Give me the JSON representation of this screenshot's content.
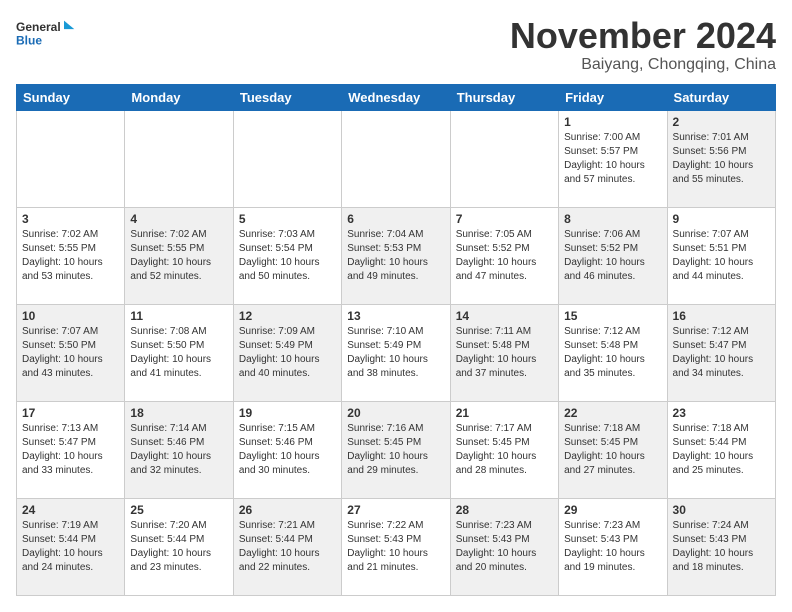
{
  "logo": {
    "line1": "General",
    "line2": "Blue"
  },
  "title": "November 2024",
  "subtitle": "Baiyang, Chongqing, China",
  "weekdays": [
    "Sunday",
    "Monday",
    "Tuesday",
    "Wednesday",
    "Thursday",
    "Friday",
    "Saturday"
  ],
  "weeks": [
    [
      {
        "day": "",
        "info": ""
      },
      {
        "day": "",
        "info": ""
      },
      {
        "day": "",
        "info": ""
      },
      {
        "day": "",
        "info": ""
      },
      {
        "day": "",
        "info": ""
      },
      {
        "day": "1",
        "info": "Sunrise: 7:00 AM\nSunset: 5:57 PM\nDaylight: 10 hours\nand 57 minutes."
      },
      {
        "day": "2",
        "info": "Sunrise: 7:01 AM\nSunset: 5:56 PM\nDaylight: 10 hours\nand 55 minutes."
      }
    ],
    [
      {
        "day": "3",
        "info": "Sunrise: 7:02 AM\nSunset: 5:55 PM\nDaylight: 10 hours\nand 53 minutes."
      },
      {
        "day": "4",
        "info": "Sunrise: 7:02 AM\nSunset: 5:55 PM\nDaylight: 10 hours\nand 52 minutes."
      },
      {
        "day": "5",
        "info": "Sunrise: 7:03 AM\nSunset: 5:54 PM\nDaylight: 10 hours\nand 50 minutes."
      },
      {
        "day": "6",
        "info": "Sunrise: 7:04 AM\nSunset: 5:53 PM\nDaylight: 10 hours\nand 49 minutes."
      },
      {
        "day": "7",
        "info": "Sunrise: 7:05 AM\nSunset: 5:52 PM\nDaylight: 10 hours\nand 47 minutes."
      },
      {
        "day": "8",
        "info": "Sunrise: 7:06 AM\nSunset: 5:52 PM\nDaylight: 10 hours\nand 46 minutes."
      },
      {
        "day": "9",
        "info": "Sunrise: 7:07 AM\nSunset: 5:51 PM\nDaylight: 10 hours\nand 44 minutes."
      }
    ],
    [
      {
        "day": "10",
        "info": "Sunrise: 7:07 AM\nSunset: 5:50 PM\nDaylight: 10 hours\nand 43 minutes."
      },
      {
        "day": "11",
        "info": "Sunrise: 7:08 AM\nSunset: 5:50 PM\nDaylight: 10 hours\nand 41 minutes."
      },
      {
        "day": "12",
        "info": "Sunrise: 7:09 AM\nSunset: 5:49 PM\nDaylight: 10 hours\nand 40 minutes."
      },
      {
        "day": "13",
        "info": "Sunrise: 7:10 AM\nSunset: 5:49 PM\nDaylight: 10 hours\nand 38 minutes."
      },
      {
        "day": "14",
        "info": "Sunrise: 7:11 AM\nSunset: 5:48 PM\nDaylight: 10 hours\nand 37 minutes."
      },
      {
        "day": "15",
        "info": "Sunrise: 7:12 AM\nSunset: 5:48 PM\nDaylight: 10 hours\nand 35 minutes."
      },
      {
        "day": "16",
        "info": "Sunrise: 7:12 AM\nSunset: 5:47 PM\nDaylight: 10 hours\nand 34 minutes."
      }
    ],
    [
      {
        "day": "17",
        "info": "Sunrise: 7:13 AM\nSunset: 5:47 PM\nDaylight: 10 hours\nand 33 minutes."
      },
      {
        "day": "18",
        "info": "Sunrise: 7:14 AM\nSunset: 5:46 PM\nDaylight: 10 hours\nand 32 minutes."
      },
      {
        "day": "19",
        "info": "Sunrise: 7:15 AM\nSunset: 5:46 PM\nDaylight: 10 hours\nand 30 minutes."
      },
      {
        "day": "20",
        "info": "Sunrise: 7:16 AM\nSunset: 5:45 PM\nDaylight: 10 hours\nand 29 minutes."
      },
      {
        "day": "21",
        "info": "Sunrise: 7:17 AM\nSunset: 5:45 PM\nDaylight: 10 hours\nand 28 minutes."
      },
      {
        "day": "22",
        "info": "Sunrise: 7:18 AM\nSunset: 5:45 PM\nDaylight: 10 hours\nand 27 minutes."
      },
      {
        "day": "23",
        "info": "Sunrise: 7:18 AM\nSunset: 5:44 PM\nDaylight: 10 hours\nand 25 minutes."
      }
    ],
    [
      {
        "day": "24",
        "info": "Sunrise: 7:19 AM\nSunset: 5:44 PM\nDaylight: 10 hours\nand 24 minutes."
      },
      {
        "day": "25",
        "info": "Sunrise: 7:20 AM\nSunset: 5:44 PM\nDaylight: 10 hours\nand 23 minutes."
      },
      {
        "day": "26",
        "info": "Sunrise: 7:21 AM\nSunset: 5:44 PM\nDaylight: 10 hours\nand 22 minutes."
      },
      {
        "day": "27",
        "info": "Sunrise: 7:22 AM\nSunset: 5:43 PM\nDaylight: 10 hours\nand 21 minutes."
      },
      {
        "day": "28",
        "info": "Sunrise: 7:23 AM\nSunset: 5:43 PM\nDaylight: 10 hours\nand 20 minutes."
      },
      {
        "day": "29",
        "info": "Sunrise: 7:23 AM\nSunset: 5:43 PM\nDaylight: 10 hours\nand 19 minutes."
      },
      {
        "day": "30",
        "info": "Sunrise: 7:24 AM\nSunset: 5:43 PM\nDaylight: 10 hours\nand 18 minutes."
      }
    ]
  ]
}
